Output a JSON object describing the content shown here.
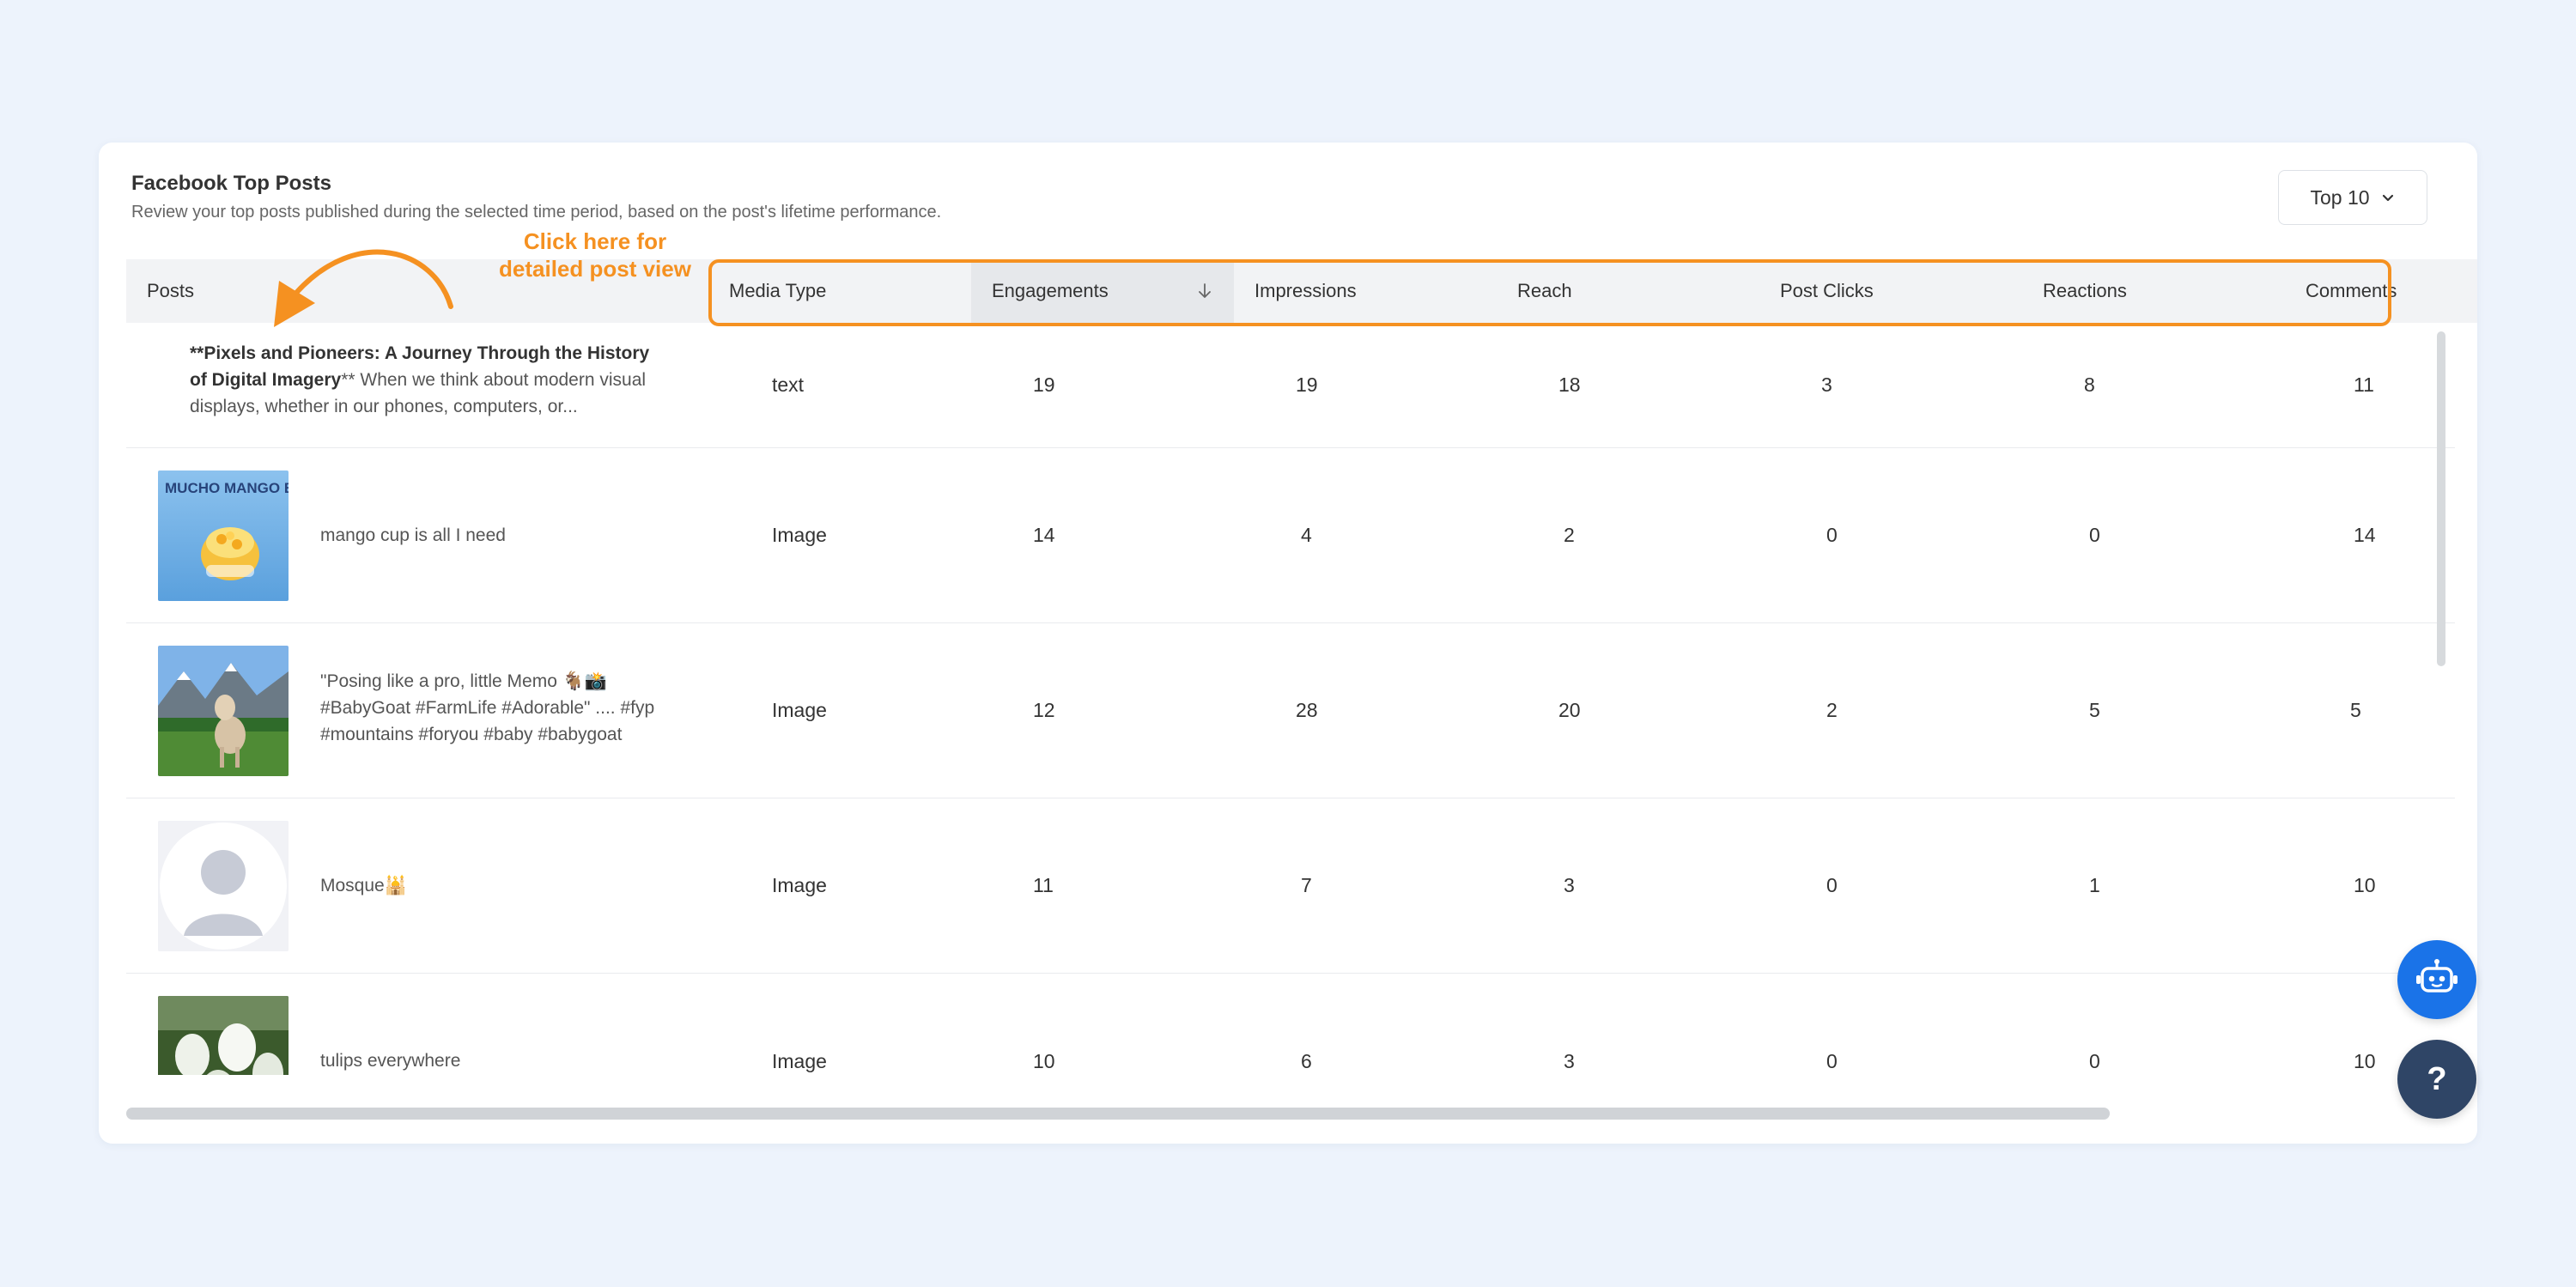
{
  "card": {
    "title": "Facebook Top Posts",
    "subtitle": "Review your top posts published during the selected time period, based on the post's lifetime performance.",
    "top_select": "Top 10"
  },
  "annotation": {
    "line1": "Click here for",
    "line2": "detailed post view",
    "color": "#f59121"
  },
  "columns": {
    "posts": "Posts",
    "media_type": "Media Type",
    "engagements": "Engagements",
    "impressions": "Impressions",
    "reach": "Reach",
    "post_clicks": "Post Clicks",
    "reactions": "Reactions",
    "comments": "Comments",
    "sorted_column": "engagements"
  },
  "rows": [
    {
      "thumb": "none",
      "text_bold": "**Pixels and Pioneers: A Journey Through the History of Digital Imagery",
      "text_rest": "** When we think about modern visual displays, whether in our phones, computers, or...",
      "media_type": "text",
      "engagements": "19",
      "impressions": "19",
      "reach": "18",
      "post_clicks": "3",
      "reactions": "8",
      "comments": "11"
    },
    {
      "thumb": "mango-bowl-image",
      "thumb_caption": "MUCHO MANGO BOWL",
      "text": "mango cup is all I need",
      "media_type": "Image",
      "engagements": "14",
      "impressions": "4",
      "reach": "2",
      "post_clicks": "0",
      "reactions": "0",
      "comments": "14"
    },
    {
      "thumb": "goat-mountain-image",
      "text_line1": "\"Posing like a pro, little Memo 🐐📸",
      "text_line2": "#BabyGoat #FarmLife #Adorable\" .... #fyp",
      "text_line3": "#mountains #foryou #baby #babygoat",
      "media_type": "Image",
      "engagements": "12",
      "impressions": "28",
      "reach": "20",
      "post_clicks": "2",
      "reactions": "5",
      "comments": "5"
    },
    {
      "thumb": "avatar-placeholder-image",
      "text": "Mosque🕌",
      "media_type": "Image",
      "engagements": "11",
      "impressions": "7",
      "reach": "3",
      "post_clicks": "0",
      "reactions": "1",
      "comments": "10"
    },
    {
      "thumb": "tulips-image",
      "text": "tulips everywhere",
      "media_type": "Image",
      "engagements": "10",
      "impressions": "6",
      "reach": "3",
      "post_clicks": "0",
      "reactions": "0",
      "comments": "10"
    }
  ],
  "floating": {
    "bot_icon": "robot-icon",
    "help_label": "?"
  },
  "colors": {
    "accent_orange": "#f59121",
    "bot_blue": "#1a73e8",
    "help_navy": "#2f4566",
    "background": "#edf3fc"
  }
}
